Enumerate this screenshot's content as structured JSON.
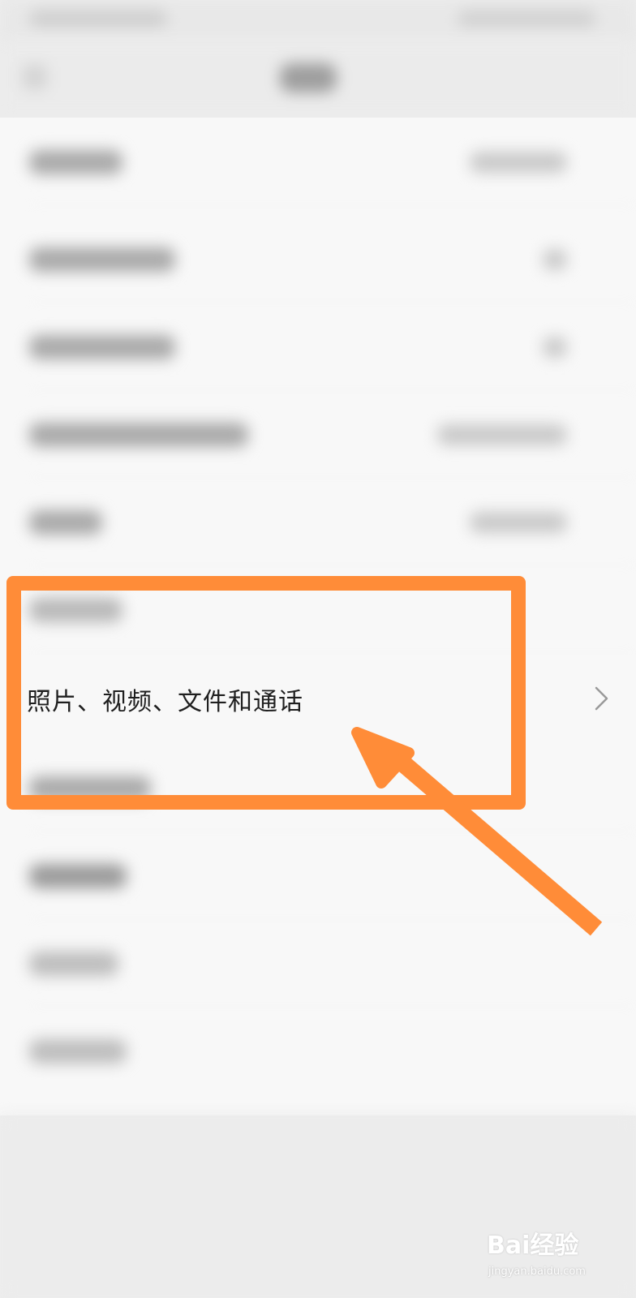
{
  "settings_list": {
    "highlighted_row": {
      "label": "照片、视频、文件和通话",
      "chevron_icon": "chevron-right-icon"
    }
  },
  "annotation": {
    "highlight_color": "#ff8c38",
    "arrow_color": "#ff8c38"
  },
  "watermark": {
    "brand": "Bai经验",
    "site": "jingyan.baidu.com"
  }
}
